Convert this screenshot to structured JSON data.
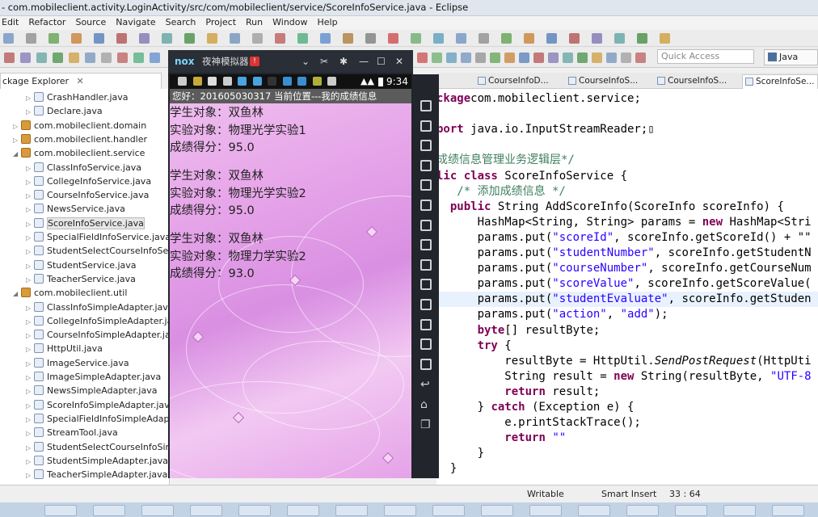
{
  "window": {
    "title": "- com.mobileclient.activity.LoginActivity/src/com/mobileclient/service/ScoreInfoService.java - Eclipse"
  },
  "menu": [
    "Edit",
    "Refactor",
    "Source",
    "Navigate",
    "Search",
    "Project",
    "Run",
    "Window",
    "Help"
  ],
  "quick_access": {
    "placeholder": "Quick Access"
  },
  "perspective": {
    "label": "Java"
  },
  "package_explorer": {
    "title": "ckage Explorer",
    "rows": [
      {
        "indent": 2,
        "type": "file",
        "label": "CrashHandler.java"
      },
      {
        "indent": 2,
        "type": "file",
        "label": "Declare.java"
      },
      {
        "indent": 1,
        "type": "pkg",
        "label": "com.mobileclient.domain",
        "twisty": "▷"
      },
      {
        "indent": 1,
        "type": "pkg",
        "label": "com.mobileclient.handler",
        "twisty": "▷"
      },
      {
        "indent": 1,
        "type": "pkg",
        "label": "com.mobileclient.service",
        "twisty": "◢"
      },
      {
        "indent": 2,
        "type": "file",
        "label": "ClassInfoService.java"
      },
      {
        "indent": 2,
        "type": "file",
        "label": "CollegeInfoService.java"
      },
      {
        "indent": 2,
        "type": "file",
        "label": "CourseInfoService.java"
      },
      {
        "indent": 2,
        "type": "file",
        "label": "NewsService.java"
      },
      {
        "indent": 2,
        "type": "file",
        "label": "ScoreInfoService.java"
      },
      {
        "indent": 2,
        "type": "file",
        "label": "SpecialFieldInfoService.java"
      },
      {
        "indent": 2,
        "type": "file",
        "label": "StudentSelectCourseInfoServi"
      },
      {
        "indent": 2,
        "type": "file",
        "label": "StudentService.java"
      },
      {
        "indent": 2,
        "type": "file",
        "label": "TeacherService.java"
      },
      {
        "indent": 1,
        "type": "pkg",
        "label": "com.mobileclient.util",
        "twisty": "◢"
      },
      {
        "indent": 2,
        "type": "file",
        "label": "ClassInfoSimpleAdapter.java"
      },
      {
        "indent": 2,
        "type": "file",
        "label": "CollegeInfoSimpleAdapter.jav"
      },
      {
        "indent": 2,
        "type": "file",
        "label": "CourseInfoSimpleAdapter.java"
      },
      {
        "indent": 2,
        "type": "file",
        "label": "HttpUtil.java"
      },
      {
        "indent": 2,
        "type": "file",
        "label": "ImageService.java"
      },
      {
        "indent": 2,
        "type": "file",
        "label": "ImageSimpleAdapter.java"
      },
      {
        "indent": 2,
        "type": "file",
        "label": "NewsSimpleAdapter.java"
      },
      {
        "indent": 2,
        "type": "file",
        "label": "ScoreInfoSimpleAdapter.java"
      },
      {
        "indent": 2,
        "type": "file",
        "label": "SpecialFieldInfoSimpleAdapte"
      },
      {
        "indent": 2,
        "type": "file",
        "label": "StreamTool.java"
      },
      {
        "indent": 2,
        "type": "file",
        "label": "StudentSelectCourseInfoSimp"
      },
      {
        "indent": 2,
        "type": "file",
        "label": "StudentSimpleAdapter.java"
      },
      {
        "indent": 2,
        "type": "file",
        "label": "TeacherSimpleAdapter.java"
      }
    ]
  },
  "editor_tabs": [
    "CourseInfoD...",
    "CourseInfoS...",
    "CourseInfoS...",
    "ScoreInfoSe..."
  ],
  "code_lines": [
    {
      "parts": [
        [
          "kw",
          "ckage"
        ],
        [
          "",
          "com.mobileclient.service;"
        ]
      ]
    },
    {
      "parts": [
        [
          "",
          ""
        ]
      ]
    },
    {
      "parts": [
        [
          "kw",
          "port"
        ],
        [
          "",
          " java.io.InputStreamReader;▯"
        ]
      ]
    },
    {
      "parts": [
        [
          "",
          ""
        ]
      ]
    },
    {
      "parts": [
        [
          "cm",
          "成绩信息管理业务逻辑层*/"
        ]
      ]
    },
    {
      "parts": [
        [
          "kw",
          "lic class"
        ],
        [
          "",
          " ScoreInfoService {"
        ]
      ]
    },
    {
      "parts": [
        [
          "cm",
          "   /* 添加成绩信息 */"
        ]
      ]
    },
    {
      "parts": [
        [
          "",
          "  "
        ],
        [
          "kw",
          "public"
        ],
        [
          "",
          " String AddScoreInfo(ScoreInfo scoreInfo) {"
        ]
      ]
    },
    {
      "parts": [
        [
          "",
          "      HashMap<String, String> params = "
        ],
        [
          "kw",
          "new"
        ],
        [
          "",
          " HashMap<Stri"
        ]
      ]
    },
    {
      "parts": [
        [
          "",
          "      params.put("
        ],
        [
          "st",
          "\"scoreId\""
        ],
        [
          "",
          ", scoreInfo.getScoreId() + \"\""
        ]
      ]
    },
    {
      "parts": [
        [
          "",
          "      params.put("
        ],
        [
          "st",
          "\"studentNumber\""
        ],
        [
          "",
          ", scoreInfo.getStudentN"
        ]
      ]
    },
    {
      "parts": [
        [
          "",
          "      params.put("
        ],
        [
          "st",
          "\"courseNumber\""
        ],
        [
          "",
          ", scoreInfo.getCourseNum"
        ]
      ]
    },
    {
      "parts": [
        [
          "",
          "      params.put("
        ],
        [
          "st",
          "\"scoreValue\""
        ],
        [
          "",
          ", scoreInfo.getScoreValue("
        ]
      ]
    },
    {
      "parts": [
        [
          "",
          "      params.put("
        ],
        [
          "st",
          "\"studentEvaluate\""
        ],
        [
          "",
          ", scoreInfo.getStuden"
        ]
      ],
      "hl": true
    },
    {
      "parts": [
        [
          "",
          "      params.put("
        ],
        [
          "st",
          "\"action\""
        ],
        [
          "",
          ", "
        ],
        [
          "st",
          "\"add\""
        ],
        [
          "",
          ");"
        ]
      ]
    },
    {
      "parts": [
        [
          "",
          "      "
        ],
        [
          "kw",
          "byte"
        ],
        [
          "",
          "[] resultByte;"
        ]
      ]
    },
    {
      "parts": [
        [
          "",
          "      "
        ],
        [
          "kw",
          "try"
        ],
        [
          "",
          " {"
        ]
      ]
    },
    {
      "parts": [
        [
          "",
          "          resultByte = HttpUtil."
        ],
        [
          "it",
          "SendPostRequest"
        ],
        [
          "",
          "(HttpUti"
        ]
      ]
    },
    {
      "parts": [
        [
          "",
          "          String result = "
        ],
        [
          "kw",
          "new"
        ],
        [
          "",
          " String(resultByte, "
        ],
        [
          "st",
          "\"UTF-8"
        ]
      ]
    },
    {
      "parts": [
        [
          "",
          "          "
        ],
        [
          "kw",
          "return"
        ],
        [
          "",
          " result;"
        ]
      ]
    },
    {
      "parts": [
        [
          "",
          "      } "
        ],
        [
          "kw",
          "catch"
        ],
        [
          "",
          " (Exception e) {"
        ]
      ]
    },
    {
      "parts": [
        [
          "",
          "          e.printStackTrace();"
        ]
      ]
    },
    {
      "parts": [
        [
          "",
          "          "
        ],
        [
          "kw",
          "return"
        ],
        [
          "",
          " "
        ],
        [
          "st",
          "\"\""
        ],
        [
          ";"
        ]
      ]
    },
    {
      "parts": [
        [
          "",
          "      }"
        ]
      ]
    },
    {
      "parts": [
        [
          "",
          "  }"
        ]
      ]
    }
  ],
  "nox": {
    "title": "夜神模拟器",
    "time": "9:34",
    "app_header": "您好：201605030317  当前位置---我的成绩信息",
    "records": [
      {
        "student_label": "学生对象：",
        "student": "双鱼林",
        "experiment_label": "实验对象：",
        "experiment": "物理光学实验1",
        "score_label": "成绩得分：",
        "score": "95.0"
      },
      {
        "student_label": "学生对象：",
        "student": "双鱼林",
        "experiment_label": "实验对象：",
        "experiment": "物理光学实验2",
        "score_label": "成绩得分：",
        "score": "95.0"
      },
      {
        "student_label": "学生对象：",
        "student": "双鱼林",
        "experiment_label": "实验对象：",
        "experiment": "物理力学实验2",
        "score_label": "成绩得分：",
        "score": "93.0"
      }
    ]
  },
  "status": {
    "writable": "Writable",
    "insert_mode": "Smart Insert",
    "position": "33 : 64"
  },
  "colors": {
    "keyword": "#7f0055",
    "string": "#2a00ff",
    "comment": "#3f7f5f",
    "nox_frame": "#20242a"
  }
}
